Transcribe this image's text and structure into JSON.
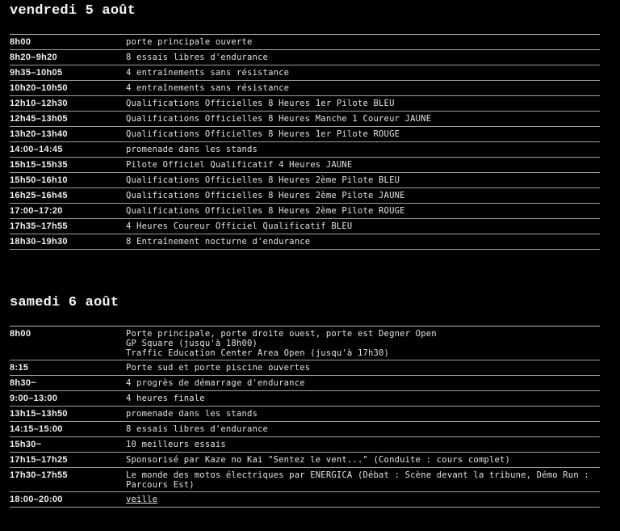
{
  "days": [
    {
      "title": "vendredi 5 août",
      "rows": [
        {
          "time": "8h00",
          "lines": [
            "porte principale ouverte"
          ]
        },
        {
          "time": "8h20–9h20",
          "lines": [
            "8 essais libres d'endurance"
          ]
        },
        {
          "time": "9h35–10h05",
          "lines": [
            "4 entraînements sans résistance"
          ]
        },
        {
          "time": "10h20–10h50",
          "lines": [
            "4 entraînements sans résistance"
          ]
        },
        {
          "time": "12h10–12h30",
          "lines": [
            "Qualifications Officielles 8 Heures 1er Pilote BLEU"
          ]
        },
        {
          "time": "12h45–13h05",
          "lines": [
            "Qualifications Officielles 8 Heures Manche 1 Coureur JAUNE"
          ]
        },
        {
          "time": "13h20–13h40",
          "lines": [
            "Qualifications Officielles 8 Heures 1er Pilote ROUGE"
          ]
        },
        {
          "time": "14:00–14:45",
          "lines": [
            "promenade dans les stands"
          ]
        },
        {
          "time": "15h15–15h35",
          "lines": [
            "Pilote Officiel Qualificatif 4 Heures JAUNE"
          ]
        },
        {
          "time": "15h50–16h10",
          "lines": [
            "Qualifications Officielles 8 Heures 2ème Pilote BLEU"
          ]
        },
        {
          "time": "16h25–16h45",
          "lines": [
            "Qualifications Officielles 8 Heures 2ème Pilote JAUNE"
          ]
        },
        {
          "time": "17:00–17:20",
          "lines": [
            "Qualifications Officielles 8 Heures 2ème Pilote ROUGE"
          ]
        },
        {
          "time": "17h35–17h55",
          "lines": [
            "4 Heures Coureur Officiel Qualificatif BLEU"
          ]
        },
        {
          "time": "18h30–19h30",
          "lines": [
            "8 Entraînement nocturne d'endurance"
          ]
        }
      ]
    },
    {
      "title": "samedi 6 août",
      "rows": [
        {
          "time": "8h00",
          "lines": [
            "Porte principale, porte droite ouest, porte est Degner Open",
            "GP Square (jusqu'à 18h00)",
            "Traffic Education Center Area Open (jusqu'à 17h30)"
          ]
        },
        {
          "time": "8:15",
          "lines": [
            "Porte sud et porte piscine ouvertes"
          ]
        },
        {
          "time": "8h30~",
          "lines": [
            "4 progrès de démarrage d'endurance"
          ]
        },
        {
          "time": "9:00–13:00",
          "lines": [
            "4 heures finale"
          ]
        },
        {
          "time": "13h15–13h50",
          "lines": [
            "promenade dans les stands"
          ]
        },
        {
          "time": "14:15–15:00",
          "lines": [
            "8 essais libres d'endurance"
          ]
        },
        {
          "time": "15h30~",
          "lines": [
            "10 meilleurs essais"
          ]
        },
        {
          "time": "17h15–17h25",
          "lines": [
            "Sponsorisé par Kaze no Kai \"Sentez le vent...\" (Conduite : cours complet)"
          ]
        },
        {
          "time": "17h30–17h55",
          "lines": [
            "Le monde des motos électriques par ENERGICA (Débat : Scène devant la tribune, Démo Run :",
            "Parcours Est)"
          ]
        },
        {
          "time": "18:00–20:00",
          "lines": [
            "veille"
          ],
          "link": true
        }
      ]
    }
  ]
}
